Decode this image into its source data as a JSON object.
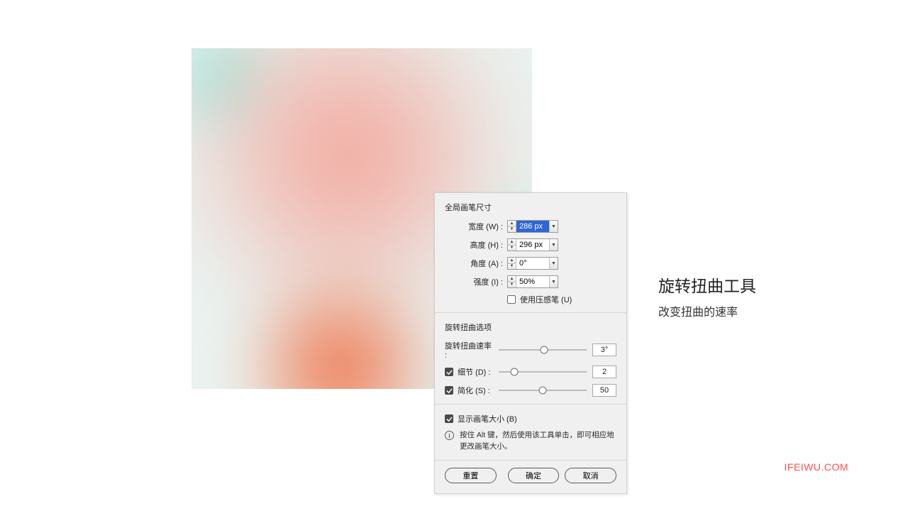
{
  "dialog": {
    "brush_section_title": "全局画笔尺寸",
    "width": {
      "label": "宽度 (W) :",
      "value": "286 px"
    },
    "height": {
      "label": "高度 (H) :",
      "value": "296 px"
    },
    "angle": {
      "label": "角度 (A) :",
      "value": "0°"
    },
    "intensity": {
      "label": "强度 (I) :",
      "value": "50%"
    },
    "pressure_pen": {
      "label": "使用压感笔 (U)",
      "checked": false
    },
    "options_section_title": "旋转扭曲选项",
    "rate": {
      "label": "旋转扭曲速率 :",
      "value": "3°",
      "pos": 52
    },
    "detail": {
      "label": "细节 (D) :",
      "checked": true,
      "value": "2",
      "pos": 18
    },
    "simplify": {
      "label": "简化 (S) :",
      "checked": true,
      "value": "50",
      "pos": 50
    },
    "show_brush": {
      "label": "显示画笔大小 (B)",
      "checked": true
    },
    "tip": "按住 Alt 键，然后使用该工具单击，即可相应地更改画笔大小。",
    "buttons": {
      "reset": "重置",
      "ok": "确定",
      "cancel": "取消"
    }
  },
  "side": {
    "title": "旋转扭曲工具",
    "subtitle": "改变扭曲的速率"
  },
  "watermark": "IFEIWU.COM"
}
